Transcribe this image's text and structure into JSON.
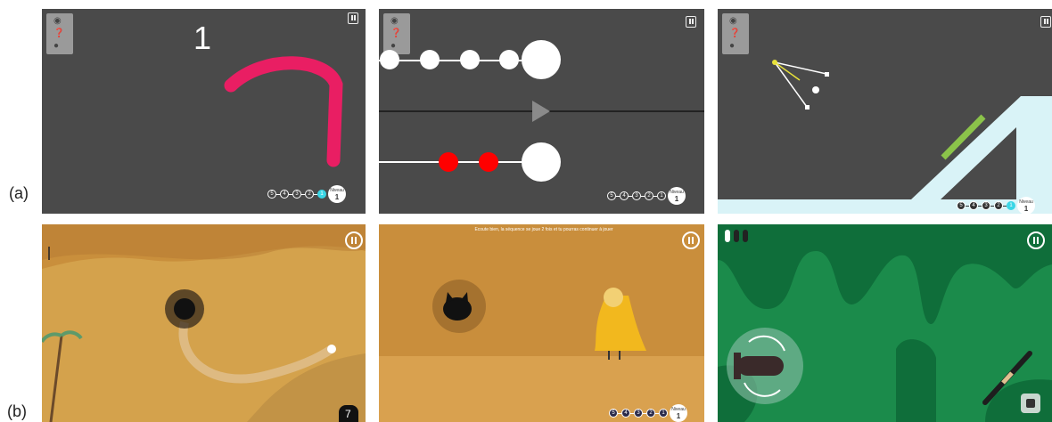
{
  "labels": {
    "row_a": "(a)",
    "row_b": "(b)"
  },
  "panel_a1": {
    "counter": "1",
    "levels": [
      "5",
      "4",
      "3",
      "2",
      "1"
    ],
    "badge_title": "Niveau",
    "badge_num": "1"
  },
  "panel_a2": {
    "levels": [
      "5",
      "4",
      "3",
      "2",
      "1"
    ],
    "badge_title": "Niveau",
    "badge_num": "1"
  },
  "panel_a3": {
    "levels": [
      "5",
      "4",
      "3",
      "2",
      "1"
    ],
    "badge_title": "Niveau",
    "badge_num": "1"
  },
  "panel_b1": {
    "lives": "7"
  },
  "panel_b2": {
    "instruction": "Ecoute bien, la séquence se joue 2 fois et tu pourras continuer à jouer",
    "levels": [
      "5",
      "4",
      "3",
      "2",
      "1"
    ],
    "badge_title": "Niveau",
    "badge_num": "1"
  },
  "panel_b3": {},
  "colors": {
    "dark_panel": "#4a4a4a",
    "pink": "#e91e63",
    "red": "#ff0000",
    "cyan": "#3ad6e6",
    "lime": "#8bc34a",
    "sand": "#d4a24c",
    "green": "#1b8b4b"
  }
}
